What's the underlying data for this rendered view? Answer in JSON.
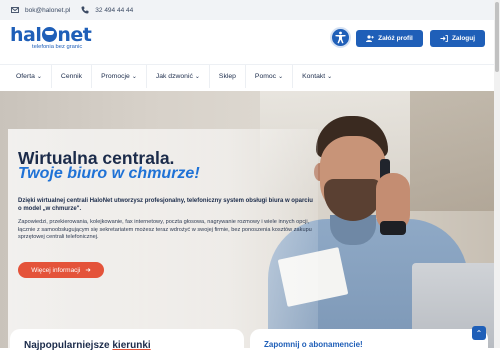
{
  "topbar": {
    "email": "bok@halonet.pl",
    "phone": "32 494 44 44"
  },
  "logo": {
    "word_start": "hal",
    "word_end": "net",
    "tagline": "telefonia bez granic"
  },
  "header": {
    "signup_label": "Załóż profil",
    "login_label": "Zaloguj"
  },
  "nav": {
    "items": [
      {
        "label": "Oferta",
        "dropdown": true
      },
      {
        "label": "Cennik",
        "dropdown": false
      },
      {
        "label": "Promocje",
        "dropdown": true
      },
      {
        "label": "Jak dzwonić",
        "dropdown": true
      },
      {
        "label": "Sklep",
        "dropdown": false
      },
      {
        "label": "Pomoc",
        "dropdown": true
      },
      {
        "label": "Kontakt",
        "dropdown": true
      }
    ]
  },
  "hero": {
    "title": "Wirtualna centrala.",
    "subtitle": "Twoje biuro w chmurze!",
    "bold_text": "Dzięki wirtualnej centrali HaloNet utworzysz profesjonalny, telefoniczny system obsługi biura w oparciu o model „w chmurze\".",
    "description": "Zapowiedzi, przekierowania, kolejkowanie, fax internetowy, poczta głosowa, nagrywanie rozmowy i wiele innych opcji, łącznie z samoobsługującym się sekretariatem możesz teraz wdrożyć w swojej firmie, bez ponoszenia kosztów zakupu sprzętowej centrali telefonicznej.",
    "cta_label": "Więcej informacji"
  },
  "cards": {
    "left_title_start": "Najpopularniejsze ",
    "left_title_highlight": "kierunki",
    "right_title": "Zapomnij o abonamencie!"
  },
  "colors": {
    "brand": "#1f5fb8",
    "accent": "#e4533a",
    "highlight": "#1f72d6"
  }
}
